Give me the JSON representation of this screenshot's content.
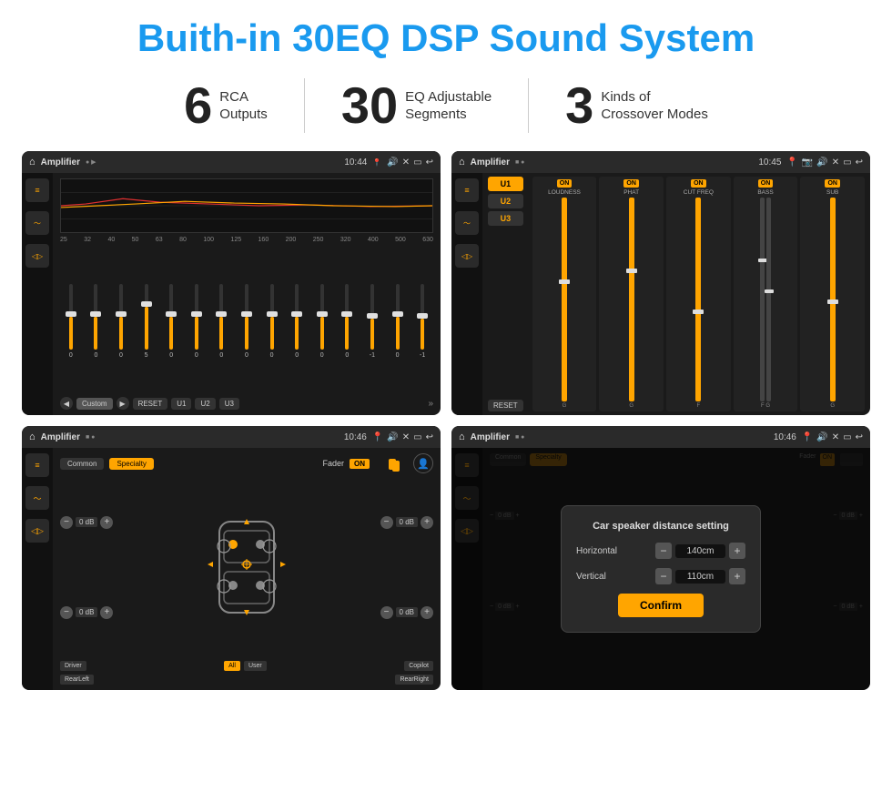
{
  "header": {
    "title": "Buith-in 30EQ DSP Sound System"
  },
  "stats": [
    {
      "number": "6",
      "text_line1": "RCA",
      "text_line2": "Outputs"
    },
    {
      "number": "30",
      "text_line1": "EQ Adjustable",
      "text_line2": "Segments"
    },
    {
      "number": "3",
      "text_line1": "Kinds of",
      "text_line2": "Crossover Modes"
    }
  ],
  "screens": [
    {
      "id": "screen1",
      "bar": {
        "title": "Amplifier",
        "time": "10:44"
      },
      "type": "eq"
    },
    {
      "id": "screen2",
      "bar": {
        "title": "Amplifier",
        "time": "10:45"
      },
      "type": "amp2"
    },
    {
      "id": "screen3",
      "bar": {
        "title": "Amplifier",
        "time": "10:46"
      },
      "type": "fader"
    },
    {
      "id": "screen4",
      "bar": {
        "title": "Amplifier",
        "time": "10:46"
      },
      "type": "fader-dialog"
    }
  ],
  "eq": {
    "freqs": [
      "25",
      "32",
      "40",
      "50",
      "63",
      "80",
      "100",
      "125",
      "160",
      "200",
      "250",
      "320",
      "400",
      "500",
      "630"
    ],
    "values": [
      "0",
      "0",
      "0",
      "5",
      "0",
      "0",
      "0",
      "0",
      "0",
      "0",
      "0",
      "0",
      "-1",
      "0",
      "-1"
    ],
    "preset": "Custom",
    "buttons": [
      "RESET",
      "U1",
      "U2",
      "U3"
    ]
  },
  "amp2": {
    "presets": [
      "U1",
      "U2",
      "U3"
    ],
    "channels": [
      {
        "label": "LOUDNESS",
        "on": true
      },
      {
        "label": "PHAT",
        "on": true
      },
      {
        "label": "CUT FREQ",
        "on": true
      },
      {
        "label": "BASS",
        "on": true
      },
      {
        "label": "SUB",
        "on": true
      }
    ],
    "reset": "RESET"
  },
  "fader": {
    "tabs": [
      "Common",
      "Specialty"
    ],
    "activeTab": "Specialty",
    "faderLabel": "Fader",
    "faderOn": "ON",
    "controls": [
      {
        "label": "Driver",
        "db": "0 dB"
      },
      {
        "label": "Copilot",
        "db": "0 dB"
      },
      {
        "label": "RearLeft",
        "db": "0 dB"
      },
      {
        "label": "RearRight",
        "db": "0 dB"
      }
    ],
    "allBtn": "All",
    "userBtn": "User",
    "rearLeftBtn": "RearLeft",
    "rearRightBtn": "RearRight",
    "driverBtn": "Driver",
    "copilotBtn": "Copilot"
  },
  "dialog": {
    "title": "Car speaker distance setting",
    "horizontal": {
      "label": "Horizontal",
      "value": "140cm"
    },
    "vertical": {
      "label": "Vertical",
      "value": "110cm"
    },
    "confirmLabel": "Confirm"
  }
}
